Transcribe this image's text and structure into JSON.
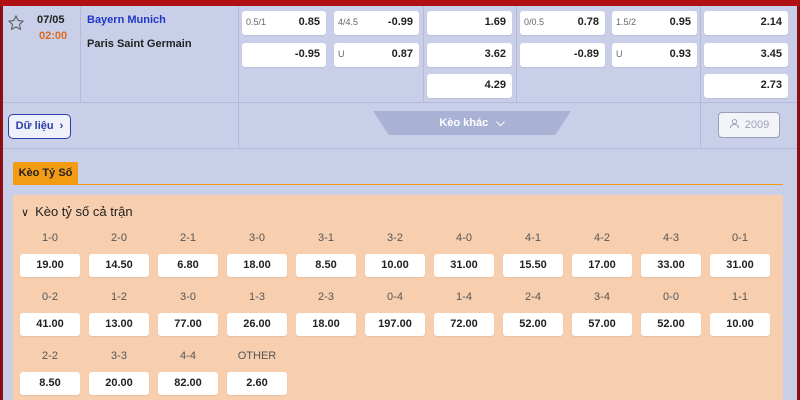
{
  "match": {
    "date": "07/05",
    "time": "02:00",
    "home_team": "Bayern Munich",
    "away_team": "Paris Saint Germain"
  },
  "odds": {
    "fulltime_handicap": {
      "home_line": "0.5/1",
      "home": "0.85",
      "away_line": "",
      "away": "-0.95"
    },
    "fulltime_overunder": {
      "over_line": "4/4.5",
      "over": "-0.99",
      "under_line": "U",
      "under": "0.87"
    },
    "fulltime_1x2": {
      "home": "1.69",
      "away": "3.62",
      "draw": "4.29"
    },
    "halftime_handicap": {
      "home_line": "0/0.5",
      "home": "0.78",
      "away_line": "",
      "away": "-0.89"
    },
    "halftime_overunder": {
      "over_line": "1.5/2",
      "over": "0.95",
      "under_line": "U",
      "under": "0.93"
    },
    "halftime_1x2": {
      "home": "2.14",
      "away": "3.45",
      "draw": "2.73"
    }
  },
  "actions": {
    "data_label": "Dữ liệu",
    "more_bets_label": "Kèo khác",
    "viewer_count": "2009"
  },
  "tabs": [
    {
      "label": "Kèo Tỷ Số"
    }
  ],
  "correct_score": {
    "title": "Kèo tỷ số cả trận",
    "rows": [
      [
        {
          "score": "1-0",
          "odd": "19.00"
        },
        {
          "score": "2-0",
          "odd": "14.50"
        },
        {
          "score": "2-1",
          "odd": "6.80"
        },
        {
          "score": "3-0",
          "odd": "18.00"
        },
        {
          "score": "3-1",
          "odd": "8.50"
        },
        {
          "score": "3-2",
          "odd": "10.00"
        },
        {
          "score": "4-0",
          "odd": "31.00"
        },
        {
          "score": "4-1",
          "odd": "15.50"
        },
        {
          "score": "4-2",
          "odd": "17.00"
        },
        {
          "score": "4-3",
          "odd": "33.00"
        },
        {
          "score": "0-1",
          "odd": "31.00"
        }
      ],
      [
        {
          "score": "0-2",
          "odd": "41.00"
        },
        {
          "score": "1-2",
          "odd": "13.00"
        },
        {
          "score": "3-0",
          "odd": "77.00"
        },
        {
          "score": "1-3",
          "odd": "26.00"
        },
        {
          "score": "2-3",
          "odd": "18.00"
        },
        {
          "score": "0-4",
          "odd": "197.00"
        },
        {
          "score": "1-4",
          "odd": "72.00"
        },
        {
          "score": "2-4",
          "odd": "52.00"
        },
        {
          "score": "3-4",
          "odd": "57.00"
        },
        {
          "score": "0-0",
          "odd": "52.00"
        },
        {
          "score": "1-1",
          "odd": "10.00"
        }
      ],
      [
        {
          "score": "2-2",
          "odd": "8.50"
        },
        {
          "score": "3-3",
          "odd": "20.00"
        },
        {
          "score": "4-4",
          "odd": "82.00"
        },
        {
          "score": "OTHER",
          "odd": "2.60"
        }
      ]
    ]
  },
  "colors": {
    "accent_orange": "#f39b13",
    "time_orange": "#e06a1c",
    "team_blue": "#2237c6",
    "panel_peach": "#f7cfaf",
    "frame_red": "#b00f14"
  }
}
